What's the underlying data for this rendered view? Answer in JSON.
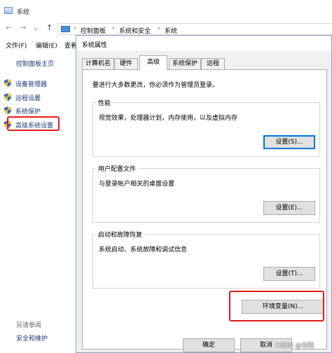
{
  "window": {
    "title": "系统"
  },
  "nav": {
    "back": "←",
    "forward": "→",
    "dropdown": "∨",
    "up": "↑"
  },
  "address": {
    "crumbs": [
      "控制面板",
      "系统和安全",
      "系统"
    ],
    "separator": "›"
  },
  "menu": {
    "items": [
      "文件(F)",
      "编辑(E)",
      "查看"
    ]
  },
  "sidebar": {
    "home": "控制面板主页",
    "items": [
      {
        "label": "设备管理器",
        "icon": "shield-icon"
      },
      {
        "label": "远程设置",
        "icon": "shield-icon"
      },
      {
        "label": "系统保护",
        "icon": "shield-icon"
      },
      {
        "label": "高级系统设置",
        "icon": "shield-icon",
        "highlighted": true
      }
    ],
    "see_also": "另请参阅",
    "security_link": "安全和维护"
  },
  "dialog": {
    "title": "系统属性",
    "tabs": [
      "计算机名",
      "硬件",
      "高级",
      "系统保护",
      "远程"
    ],
    "active_tab": "高级",
    "admin_note": "要进行大多数更改，你必须作为管理员登录。",
    "performance": {
      "title": "性能",
      "desc": "视觉效果，处理器计划，内存使用，以及虚拟内存",
      "button": "设置(S)..."
    },
    "user_profiles": {
      "title": "用户配置文件",
      "desc": "与登录帐户相关的桌面设置",
      "button": "设置(E)..."
    },
    "startup_recovery": {
      "title": "启动和故障恢复",
      "desc": "系统启动、系统故障和调试信息",
      "button": "设置(T)..."
    },
    "env_button": "环境变量(N)...",
    "ok": "确定",
    "cancel": "取消"
  },
  "watermark": "CSDN @也阳",
  "colors": {
    "highlight_red": "#e21a1a",
    "focus_blue": "#0078d7",
    "link_blue": "#1a3a78"
  }
}
